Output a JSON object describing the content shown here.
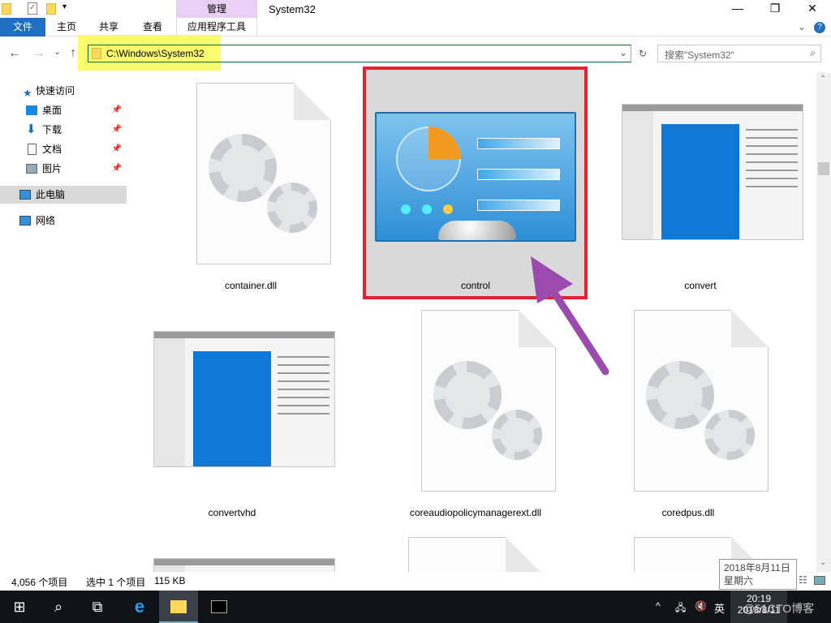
{
  "window": {
    "title": "System32",
    "context_tab": "管理",
    "minimize": "—",
    "maximize": "❐",
    "close": "✕"
  },
  "ribbon": {
    "tabs": [
      "文件",
      "主页",
      "共享",
      "查看",
      "应用程序工具"
    ],
    "help": "?",
    "expand": "⌄"
  },
  "nav": {
    "back": "←",
    "forward": "→",
    "recent": "⌄",
    "up": "↑",
    "address": "C:\\Windows\\System32",
    "refresh": "↻",
    "search_placeholder": "搜索\"System32\""
  },
  "sidebar": {
    "items": [
      {
        "label": "快速访问",
        "icon": "star-icon"
      },
      {
        "label": "桌面",
        "icon": "desktop-icon",
        "pinned": true
      },
      {
        "label": "下载",
        "icon": "download-icon",
        "pinned": true
      },
      {
        "label": "文档",
        "icon": "document-icon",
        "pinned": true
      },
      {
        "label": "图片",
        "icon": "pictures-icon",
        "pinned": true
      },
      {
        "label": "此电脑",
        "icon": "computer-icon",
        "selected": true
      },
      {
        "label": "网络",
        "icon": "network-icon"
      }
    ]
  },
  "files": [
    {
      "name": "container.dll",
      "type": "dll"
    },
    {
      "name": "control",
      "type": "control-panel",
      "selected": true
    },
    {
      "name": "convert",
      "type": "exe"
    },
    {
      "name": "convertvhd",
      "type": "exe"
    },
    {
      "name": "coreaudiopolicymanagerext.dll",
      "type": "dll"
    },
    {
      "name": "coredpus.dll",
      "type": "dll"
    }
  ],
  "status": {
    "count": "4,056 个项目",
    "selected": "选中 1 个项目",
    "size": "115 KB"
  },
  "tooltip": {
    "date": "2018年8月11日",
    "weekday": "星期六"
  },
  "taskbar": {
    "time": "20:19",
    "date": "2018/8/11",
    "ime": "英",
    "watermark": "@51CTO博客"
  }
}
